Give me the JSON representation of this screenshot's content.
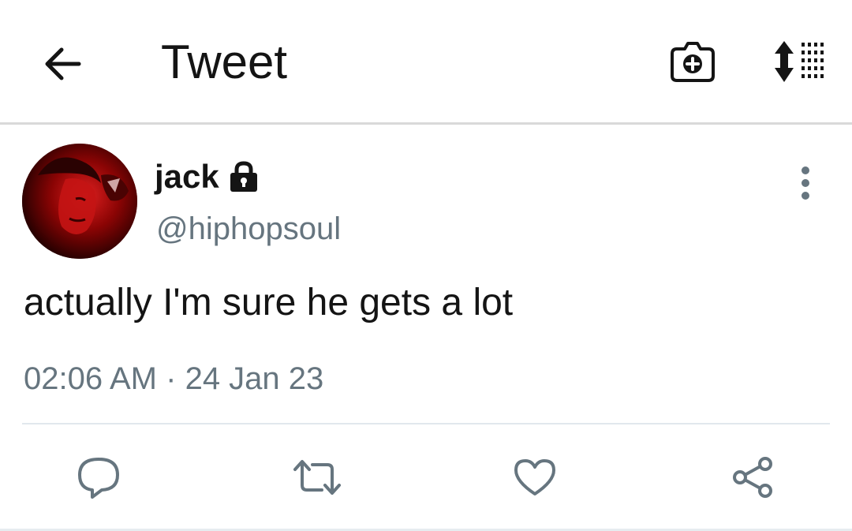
{
  "header": {
    "title": "Tweet",
    "back_icon": "arrow-left-icon",
    "camera_icon": "camera-plus-icon",
    "sort_icon": "sort-list-icon"
  },
  "tweet": {
    "display_name": "jack",
    "handle": "@hiphopsoul",
    "text": "actually I'm sure he gets a lot",
    "time": "02:06 AM",
    "separator": "·",
    "date": "24 Jan 23",
    "protected_icon": "lock-icon",
    "more_icon": "more-vertical-icon"
  },
  "actions": {
    "reply_icon": "reply-icon",
    "retweet_icon": "retweet-icon",
    "like_icon": "heart-icon",
    "share_icon": "share-icon"
  },
  "colors": {
    "text_primary": "#141414",
    "text_secondary": "#66757f",
    "icon_gray": "#66757f",
    "divider": "#e1e8ed",
    "avatar_red": "#c81010"
  }
}
